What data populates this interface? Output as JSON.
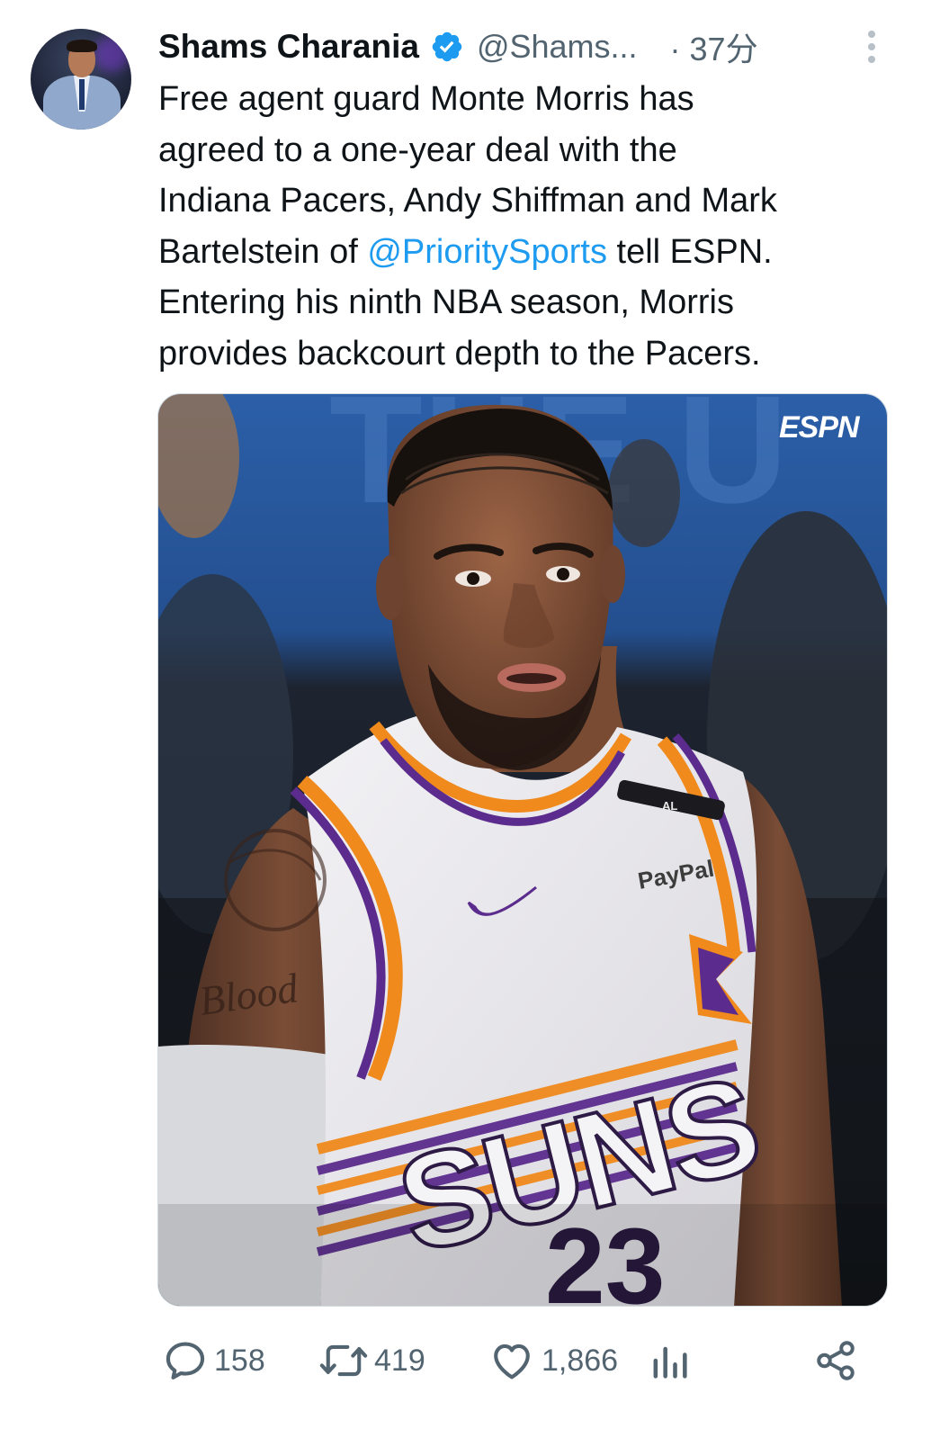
{
  "author": {
    "display_name": "Shams Charania",
    "handle": "@Shams...",
    "time": "· 37分",
    "verified": true,
    "verified_color": "#1d9bf0"
  },
  "tweet": {
    "text_part1": "Free agent guard Monte Morris has\nagreed to a one-year deal with the\nIndiana Pacers, Andy Shiffman and Mark\nBartelstein of ",
    "mention": "@PrioritySports",
    "text_part2": " tell ESPN.\nEntering his ninth NBA season, Morris\nprovides backcourt depth to the Pacers.",
    "mention_color": "#1d9bf0"
  },
  "media": {
    "watermark": "ESPN",
    "jersey_sponsor": "PayPal",
    "jersey_text": "SUNS",
    "jersey_number": "23",
    "jersey_patch": "AL",
    "tattoo_text": "Blood"
  },
  "actions": {
    "replies": "158",
    "reposts": "419",
    "likes": "1,866"
  },
  "icons": {
    "reply": "speech-bubble-icon",
    "repost": "repost-arrows-icon",
    "like": "heart-icon",
    "views": "bar-chart-icon",
    "share": "share-nodes-icon",
    "more": "vertical-dots-icon",
    "verified": "verified-badge-icon"
  }
}
